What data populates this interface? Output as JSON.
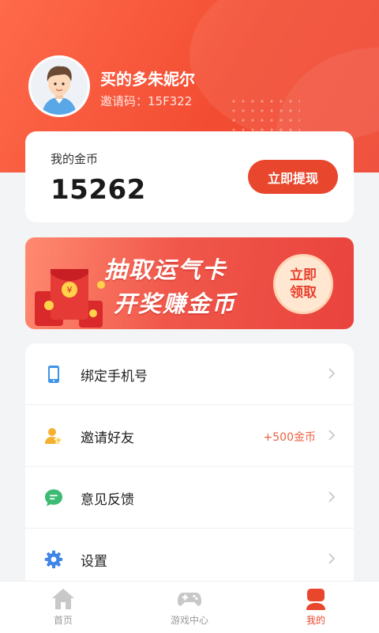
{
  "profile": {
    "username": "买的多朱妮尔",
    "invite_code": "邀请码：15F322"
  },
  "wallet": {
    "label": "我的金币",
    "coins": "15262",
    "withdraw_label": "立即提现"
  },
  "banner": {
    "line1": "抽取运气卡",
    "line2": "开奖赚金币",
    "button_line1": "立即",
    "button_line2": "领取"
  },
  "menu": {
    "items": [
      {
        "label": "绑定手机号",
        "icon": "phone-icon",
        "extra": ""
      },
      {
        "label": "邀请好友",
        "icon": "invite-friend-icon",
        "extra": "+500金币"
      },
      {
        "label": "意见反馈",
        "icon": "feedback-icon",
        "extra": ""
      },
      {
        "label": "设置",
        "icon": "gear-icon",
        "extra": ""
      }
    ]
  },
  "tabbar": {
    "tabs": [
      {
        "label": "首页",
        "icon": "home-icon"
      },
      {
        "label": "游戏中心",
        "icon": "gamepad-icon"
      },
      {
        "label": "我的",
        "icon": "profile-icon",
        "active": true
      }
    ]
  },
  "colors": {
    "brand": "#e8472e",
    "accent_text": "#ee6243",
    "tab_inactive": "#9a9a9a"
  }
}
